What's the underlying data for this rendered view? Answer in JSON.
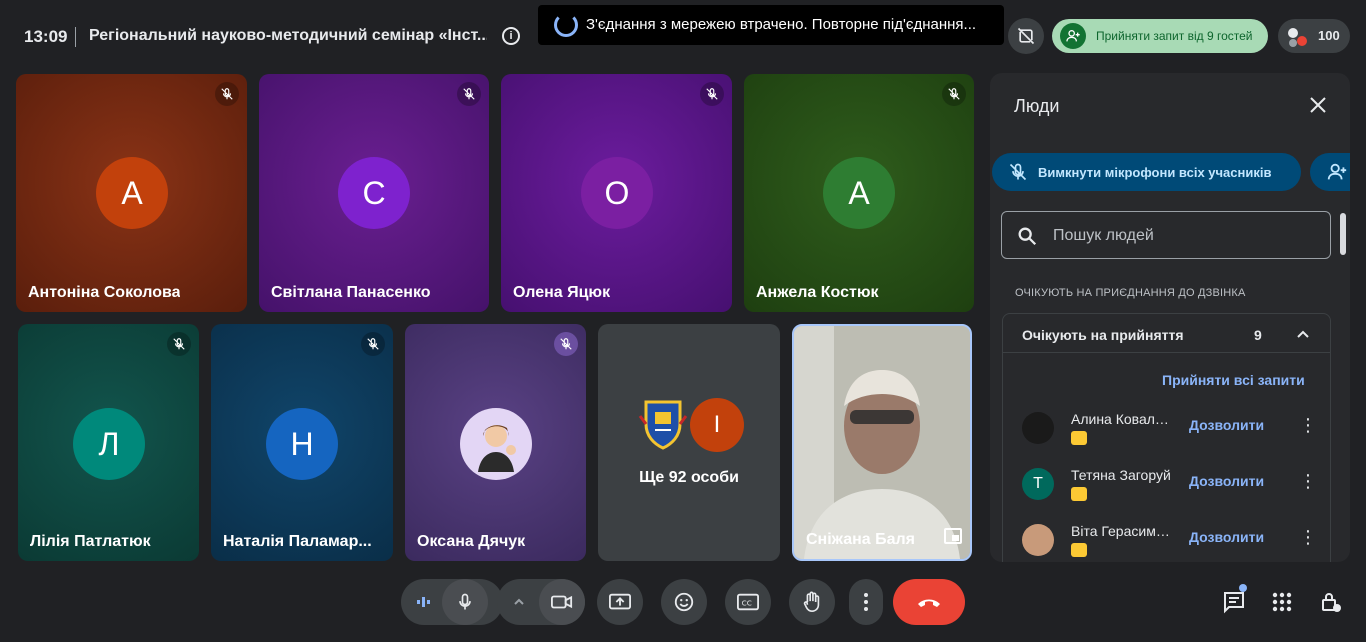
{
  "header": {
    "time": "13:09",
    "meeting_title": "Регіональний науково-методичний семінар «Інст...",
    "info_icon": "i",
    "toast_text": "З'єднання з мережею втрачено. Повторне під'єднання...",
    "accept_requests_label": "Прийняти запит від 9 гостей",
    "participants_count": "100"
  },
  "tiles": [
    {
      "name": "Антоніна Соколова",
      "initial": "А",
      "bg": "#7a2a12",
      "avatar_color": "#c2410c"
    },
    {
      "name": "Світлана Панасенко",
      "initial": "С",
      "bg": "#5a1a7a",
      "avatar_color": "#7e22ce"
    },
    {
      "name": "Олена Яцюк",
      "initial": "О",
      "bg": "#5a1a85",
      "avatar_color": "#7b1fa2"
    },
    {
      "name": "Анжела Костюк",
      "initial": "А",
      "bg": "#2e5a1a",
      "avatar_color": "#2e7d32"
    },
    {
      "name": "Лілія Патлатюк",
      "initial": "Л",
      "bg": "#0e4a44",
      "avatar_color": "#00897b"
    },
    {
      "name": "Наталія Паламар...",
      "initial": "Н",
      "bg": "#0e3a5a",
      "avatar_color": "#1565c0"
    },
    {
      "name": "Оксана Дячук",
      "initial": "",
      "bg": "#4a3470",
      "avatar_color": "#d8c6f0"
    },
    {
      "name": "Ще 92 особи",
      "initial": "І",
      "bg": "#3c4043",
      "avatar_color": "#c2410c"
    },
    {
      "name": "Сніжана Баля",
      "initial": "",
      "bg": "#b9b9b0",
      "avatar_color": "#7a8a7a"
    }
  ],
  "panel": {
    "title": "Люди",
    "mute_all_label": "Вимкнути мікрофони всіх учасників",
    "search_placeholder": "Пошук людей",
    "section_heading": "ОЧІКУЮТЬ НА ПРИЄДНАННЯ ДО ДЗВІНКА",
    "waiting_label": "Очікують на прийняття",
    "waiting_count": "9",
    "accept_all_label": "Прийняти всі запити",
    "guests": [
      {
        "name": "Алина Ковальчук",
        "initial": "",
        "avatar_color": "#1a1a1a",
        "allow_label": "Дозволити"
      },
      {
        "name": "Тетяна Загоруй",
        "initial": "Т",
        "avatar_color": "#00695c",
        "allow_label": "Дозволити"
      },
      {
        "name": "Віта Герасимчук",
        "initial": "",
        "avatar_color": "#c89a7a",
        "allow_label": "Дозволити"
      }
    ]
  },
  "controls": {
    "mic": "mic-icon",
    "camera": "camera-icon",
    "present": "present-icon",
    "emoji": "emoji-icon",
    "captions": "captions-icon",
    "raise_hand": "hand-icon",
    "more": "more-icon",
    "end_call": "end-call-icon",
    "chat": "chat-icon",
    "activities": "activities-icon",
    "host_controls": "host-controls-icon"
  }
}
